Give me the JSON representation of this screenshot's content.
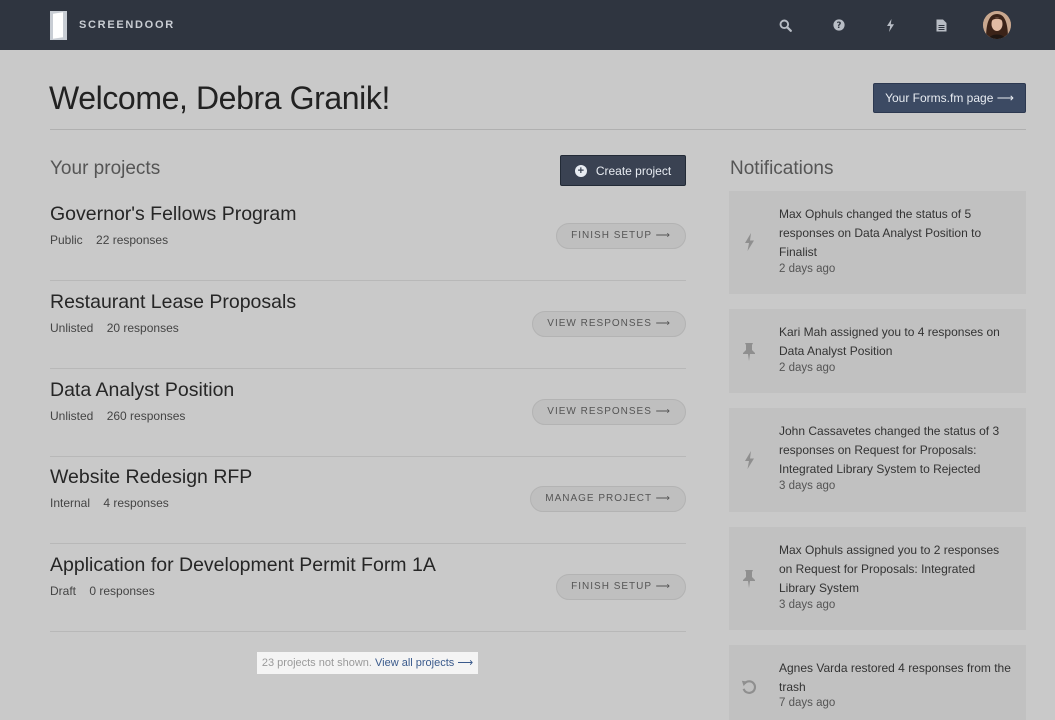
{
  "topbar": {
    "logo_text": "SCREENDOOR",
    "icons": [
      "search-icon",
      "help-icon",
      "bolt-icon",
      "document-icon"
    ]
  },
  "header": {
    "welcome": "Welcome, Debra Granik!",
    "forms_button": "Your Forms.fm page ⟶"
  },
  "projects": {
    "title": "Your projects",
    "create_label": "Create project",
    "items": [
      {
        "name": "Governor's Fellows Program",
        "visibility": "Public",
        "responses": "22 responses",
        "action": "FINISH SETUP ⟶"
      },
      {
        "name": "Restaurant Lease Proposals",
        "visibility": "Unlisted",
        "responses": "20 responses",
        "action": "VIEW RESPONSES ⟶"
      },
      {
        "name": "Data Analyst Position",
        "visibility": "Unlisted",
        "responses": "260 responses",
        "action": "VIEW RESPONSES ⟶"
      },
      {
        "name": "Website Redesign RFP",
        "visibility": "Internal",
        "responses": "4 responses",
        "action": "MANAGE PROJECT ⟶"
      },
      {
        "name": "Application for Development Permit Form 1A",
        "visibility": "Draft",
        "responses": "0 responses",
        "action": "FINISH SETUP ⟶"
      }
    ],
    "not_shown": "23 projects not shown.",
    "view_all": "View all projects ⟶"
  },
  "notifications": {
    "title": "Notifications",
    "items": [
      {
        "icon": "bolt-icon",
        "text": "Max Ophuls changed the status of 5 responses on Data Analyst Position to Finalist",
        "time": "2 days ago"
      },
      {
        "icon": "pin-icon",
        "text": "Kari Mah assigned you to 4 responses on Data Analyst Position",
        "time": "2 days ago"
      },
      {
        "icon": "bolt-icon",
        "text": "John Cassavetes changed the status of 3 responses on Request for Proposals: Integrated Library System to Rejected",
        "time": "3 days ago"
      },
      {
        "icon": "pin-icon",
        "text": "Max Ophuls assigned you to 2 responses on Request for Proposals: Integrated Library System",
        "time": "3 days ago"
      },
      {
        "icon": "restore-icon",
        "text": "Agnes Varda restored 4 responses from the trash",
        "time": "7 days ago"
      }
    ]
  }
}
